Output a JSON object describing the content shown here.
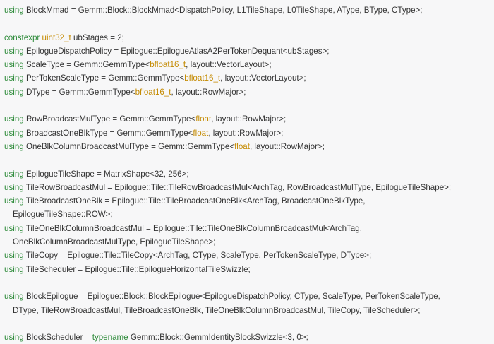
{
  "colors": {
    "background": "#f7f7f8",
    "text": "#333333",
    "keyword": "#2e8b3a",
    "type": "#c48a00"
  },
  "lines": [
    {
      "indent": false,
      "segments": [
        {
          "t": "kw",
          "v": "using"
        },
        {
          "t": "tx",
          "v": " BlockMmad = Gemm::Block::BlockMmad<DispatchPolicy, L1TileShape, L0TileShape, AType, BType, CType>;"
        }
      ]
    },
    {
      "blank": true
    },
    {
      "indent": false,
      "segments": [
        {
          "t": "kw",
          "v": "constexpr"
        },
        {
          "t": "tx",
          "v": " "
        },
        {
          "t": "ty",
          "v": "uint32_t"
        },
        {
          "t": "tx",
          "v": " ubStages = 2;"
        }
      ]
    },
    {
      "indent": false,
      "segments": [
        {
          "t": "kw",
          "v": "using"
        },
        {
          "t": "tx",
          "v": " EpilogueDispatchPolicy = Epilogue::EpilogueAtlasA2PerTokenDequant<ubStages>;"
        }
      ]
    },
    {
      "indent": false,
      "segments": [
        {
          "t": "kw",
          "v": "using"
        },
        {
          "t": "tx",
          "v": " ScaleType = Gemm::GemmType<"
        },
        {
          "t": "ty",
          "v": "bfloat16_t"
        },
        {
          "t": "tx",
          "v": ", layout::VectorLayout>;"
        }
      ]
    },
    {
      "indent": false,
      "segments": [
        {
          "t": "kw",
          "v": "using"
        },
        {
          "t": "tx",
          "v": " PerTokenScaleType = Gemm::GemmType<"
        },
        {
          "t": "ty",
          "v": "bfloat16_t"
        },
        {
          "t": "tx",
          "v": ", layout::VectorLayout>;"
        }
      ]
    },
    {
      "indent": false,
      "segments": [
        {
          "t": "kw",
          "v": "using"
        },
        {
          "t": "tx",
          "v": " DType = Gemm::GemmType<"
        },
        {
          "t": "ty",
          "v": "bfloat16_t"
        },
        {
          "t": "tx",
          "v": ", layout::RowMajor>;"
        }
      ]
    },
    {
      "blank": true
    },
    {
      "indent": false,
      "segments": [
        {
          "t": "kw",
          "v": "using"
        },
        {
          "t": "tx",
          "v": " RowBroadcastMulType = Gemm::GemmType<"
        },
        {
          "t": "ty",
          "v": "float"
        },
        {
          "t": "tx",
          "v": ", layout::RowMajor>;"
        }
      ]
    },
    {
      "indent": false,
      "segments": [
        {
          "t": "kw",
          "v": "using"
        },
        {
          "t": "tx",
          "v": " BroadcastOneBlkType = Gemm::GemmType<"
        },
        {
          "t": "ty",
          "v": "float"
        },
        {
          "t": "tx",
          "v": ", layout::RowMajor>;"
        }
      ]
    },
    {
      "indent": false,
      "segments": [
        {
          "t": "kw",
          "v": "using"
        },
        {
          "t": "tx",
          "v": " OneBlkColumnBroadcastMulType = Gemm::GemmType<"
        },
        {
          "t": "ty",
          "v": "float"
        },
        {
          "t": "tx",
          "v": ", layout::RowMajor>;"
        }
      ]
    },
    {
      "blank": true
    },
    {
      "indent": false,
      "segments": [
        {
          "t": "kw",
          "v": "using"
        },
        {
          "t": "tx",
          "v": " EpilogueTileShape = MatrixShape<32, 256>;"
        }
      ]
    },
    {
      "indent": false,
      "segments": [
        {
          "t": "kw",
          "v": "using"
        },
        {
          "t": "tx",
          "v": " TileRowBroadcastMul = Epilogue::Tile::TileRowBroadcastMul<ArchTag, RowBroadcastMulType, EpilogueTileShape>;"
        }
      ]
    },
    {
      "indent": false,
      "segments": [
        {
          "t": "kw",
          "v": "using"
        },
        {
          "t": "tx",
          "v": " TileBroadcastOneBlk = Epilogue::Tile::TileBroadcastOneBlk<ArchTag, BroadcastOneBlkType,"
        }
      ]
    },
    {
      "indent": true,
      "segments": [
        {
          "t": "tx",
          "v": "EpilogueTileShape::ROW>;"
        }
      ]
    },
    {
      "indent": false,
      "segments": [
        {
          "t": "kw",
          "v": "using"
        },
        {
          "t": "tx",
          "v": " TileOneBlkColumnBroadcastMul = Epilogue::Tile::TileOneBlkColumnBroadcastMul<ArchTag,"
        }
      ]
    },
    {
      "indent": true,
      "segments": [
        {
          "t": "tx",
          "v": "OneBlkColumnBroadcastMulType, EpilogueTileShape>;"
        }
      ]
    },
    {
      "indent": false,
      "segments": [
        {
          "t": "kw",
          "v": "using"
        },
        {
          "t": "tx",
          "v": " TileCopy = Epilogue::Tile::TileCopy<ArchTag, CType, ScaleType, PerTokenScaleType, DType>;"
        }
      ]
    },
    {
      "indent": false,
      "segments": [
        {
          "t": "kw",
          "v": "using"
        },
        {
          "t": "tx",
          "v": " TileScheduler = Epilogue::Tile::EpilogueHorizontalTileSwizzle;"
        }
      ]
    },
    {
      "blank": true
    },
    {
      "indent": false,
      "segments": [
        {
          "t": "kw",
          "v": "using"
        },
        {
          "t": "tx",
          "v": " BlockEpilogue = Epilogue::Block::BlockEpilogue<EpilogueDispatchPolicy, CType, ScaleType, PerTokenScaleType,"
        }
      ]
    },
    {
      "indent": true,
      "segments": [
        {
          "t": "tx",
          "v": "DType, TileRowBroadcastMul, TileBroadcastOneBlk, TileOneBlkColumnBroadcastMul, TileCopy, TileScheduler>;"
        }
      ]
    },
    {
      "blank": true
    },
    {
      "indent": false,
      "segments": [
        {
          "t": "kw",
          "v": "using"
        },
        {
          "t": "tx",
          "v": " BlockScheduler = "
        },
        {
          "t": "kw",
          "v": "typename"
        },
        {
          "t": "tx",
          "v": " Gemm::Block::GemmIdentityBlockSwizzle<3, 0>;"
        }
      ]
    }
  ]
}
